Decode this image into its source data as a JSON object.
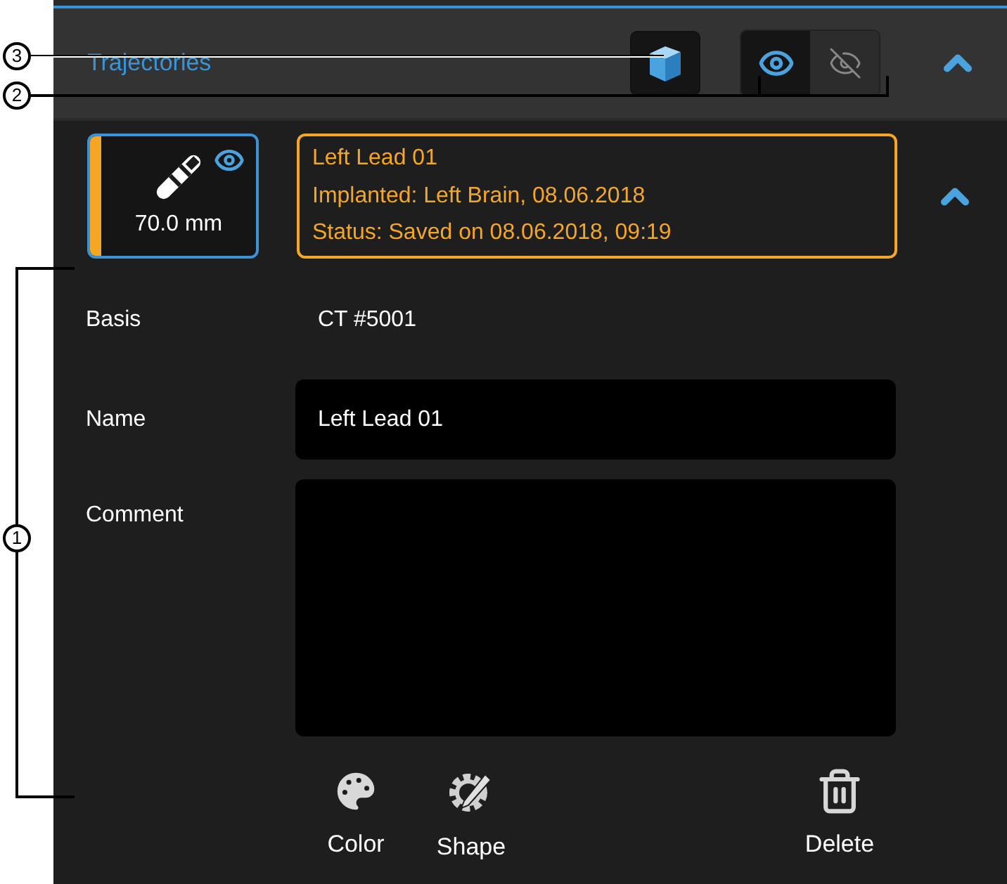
{
  "header": {
    "title": "Trajectories",
    "view_3d_pressed": true,
    "visibility": [
      {
        "kind": "visible",
        "selected": true
      },
      {
        "kind": "hidden",
        "selected": false
      }
    ]
  },
  "lead": {
    "length": "70.0 mm",
    "visible": true,
    "color": "#f5a623",
    "selected": true,
    "info": [
      "Left Lead 01",
      "Implanted: Left Brain, 08.06.2018",
      "Status: Saved on 08.06.2018, 09:19"
    ],
    "expanded": true
  },
  "form": {
    "basis_label": "Basis",
    "basis_value": "CT #5001",
    "name_label": "Name",
    "name_value": "Left Lead 01",
    "comment_label": "Comment"
  },
  "actions": [
    {
      "kind": "color",
      "label": "Color"
    },
    {
      "kind": "shape",
      "label": "Shape"
    },
    {
      "kind": "delete",
      "label": "Delete"
    }
  ],
  "callouts": [
    {
      "label": "3"
    },
    {
      "label": "2"
    },
    {
      "label": "1"
    }
  ]
}
